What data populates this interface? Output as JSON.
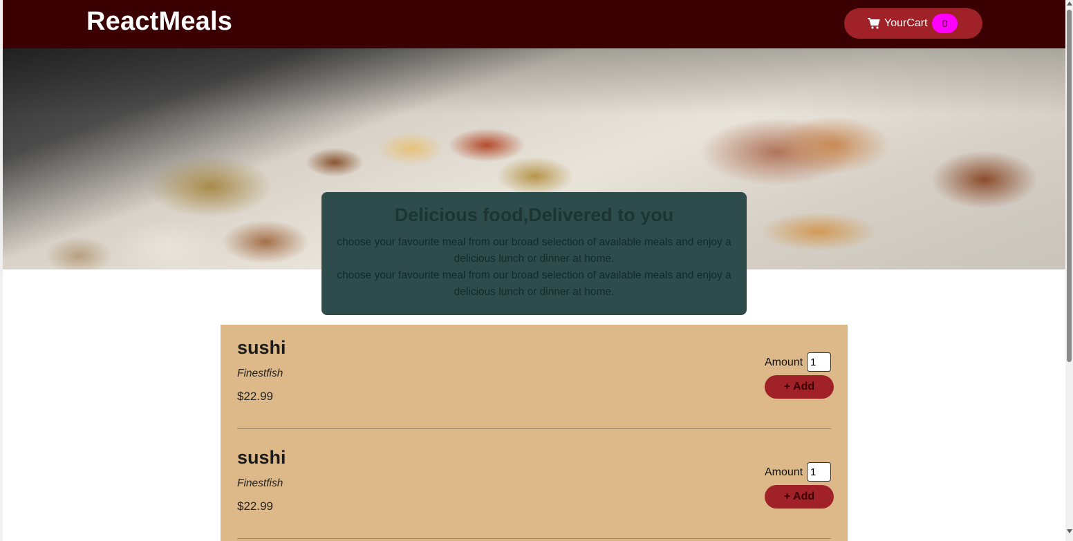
{
  "header": {
    "brand": "ReactMeals",
    "cart": {
      "label": "YourCart",
      "count": "0",
      "icon": "cart-icon"
    }
  },
  "hero": {
    "image_description_icon": "food-buffet-image"
  },
  "summary": {
    "title": "Delicious food,Delivered to you",
    "paragraphs": [
      "choose your favourite meal from our broad selection of available meals and enjoy a delicious lunch or dinner at home.",
      "choose your favourite meal from our broad selection of available meals and enjoy a delicious lunch or dinner at home."
    ]
  },
  "meals": [
    {
      "name": "sushi",
      "description": "Finestfish",
      "price": "$22.99",
      "amount_label": "Amount",
      "amount_value": "1",
      "add_label": "+ Add"
    },
    {
      "name": "sushi",
      "description": "Finestfish",
      "price": "$22.99",
      "amount_label": "Amount",
      "amount_value": "1",
      "add_label": "+ Add"
    }
  ],
  "colors": {
    "header_bg": "#3b0002",
    "accent": "#a02127",
    "badge": "#ff00ff",
    "summary_bg": "#2e4c4b",
    "meals_bg": "#ddb98a"
  }
}
